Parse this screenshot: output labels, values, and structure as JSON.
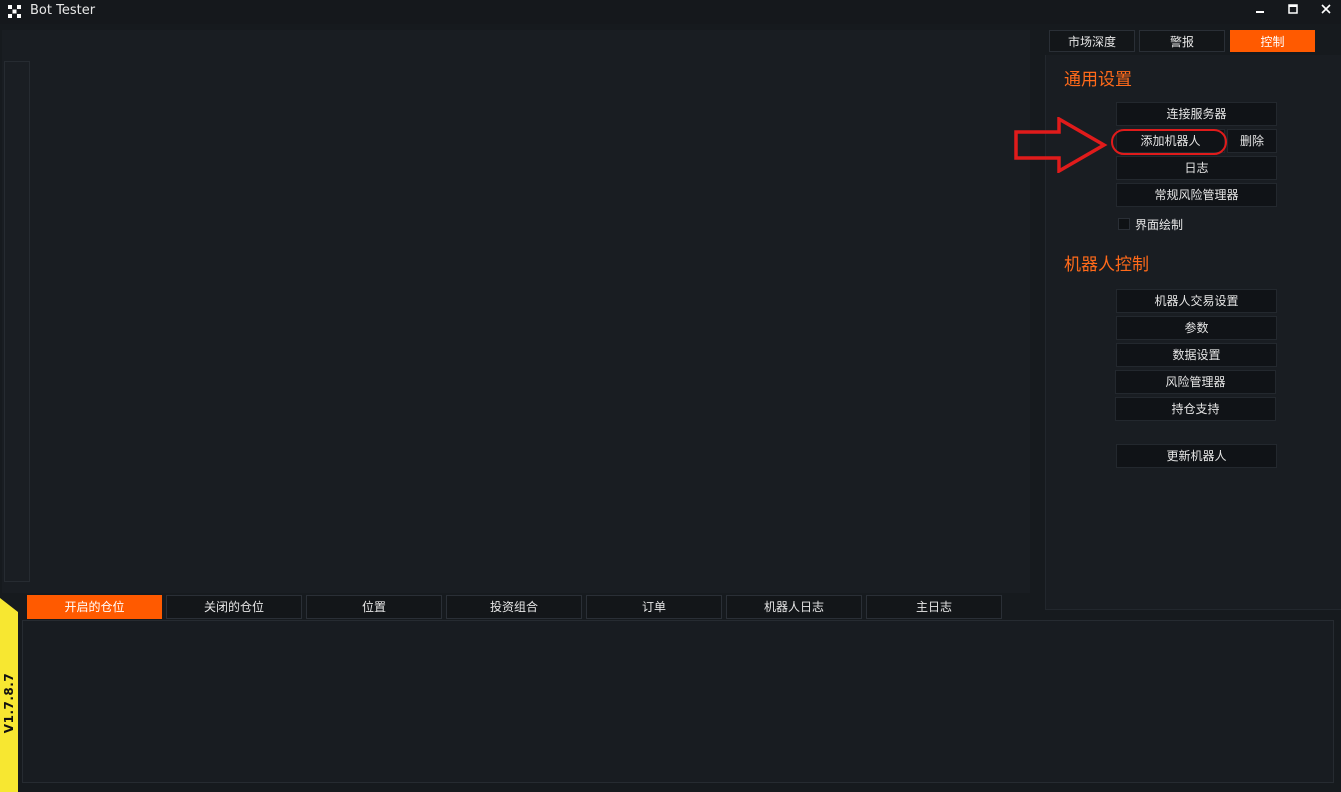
{
  "window": {
    "title": "Bot Tester",
    "minimize_icon": "minimize-icon",
    "maximize_icon": "maximize-icon",
    "close_icon": "close-icon"
  },
  "top_tabs": [
    {
      "label": "市场深度",
      "active": false
    },
    {
      "label": "警报",
      "active": false
    },
    {
      "label": "控制",
      "active": true
    }
  ],
  "general_settings": {
    "title": "通用设置",
    "connect_server": "连接服务器",
    "add_bot": "添加机器人",
    "delete": "删除",
    "log": "日志",
    "regular_risk_manager": "常规风险管理器",
    "ui_draw_label": "界面绘制"
  },
  "bot_control": {
    "title": "机器人控制",
    "trade_settings": "机器人交易设置",
    "parameters": "参数",
    "data_settings": "数据设置",
    "risk_manager": "风险管理器",
    "position_support": "持仓支持",
    "update_bot": "更新机器人"
  },
  "bottom_tabs": [
    {
      "label": "开启的仓位",
      "active": true
    },
    {
      "label": "关闭的仓位",
      "active": false
    },
    {
      "label": "位置",
      "active": false
    },
    {
      "label": "投资组合",
      "active": false
    },
    {
      "label": "订单",
      "active": false
    },
    {
      "label": "机器人日志",
      "active": false
    },
    {
      "label": "主日志",
      "active": false
    }
  ],
  "version": "V1.7.8.7",
  "colors": {
    "accent": "#ff5a00",
    "background": "#161a1e",
    "highlight": "#e01b1b",
    "version_bg": "#f7e731"
  }
}
